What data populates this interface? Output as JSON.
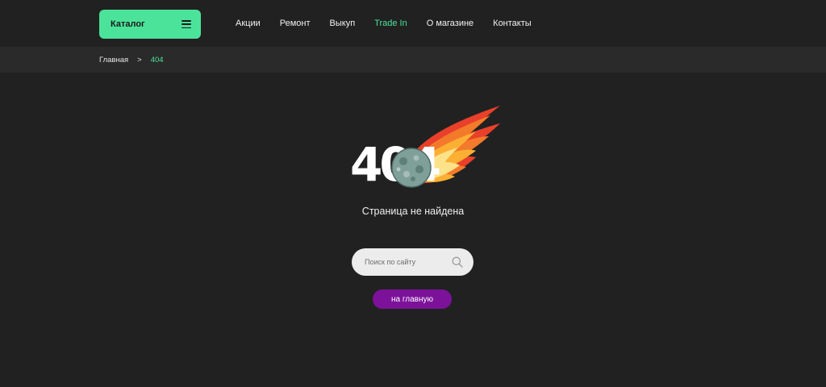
{
  "header": {
    "catalog_label": "Каталог",
    "nav": [
      "Акции",
      "Ремонт",
      "Выкуп",
      "Trade In",
      "О магазине",
      "Контакты"
    ],
    "active_item": "Trade In"
  },
  "breadcrumbs": {
    "home": "Главная",
    "separator": ">",
    "current": "404"
  },
  "error": {
    "code": "404",
    "message": "Страница не найдена"
  },
  "search": {
    "placeholder": "Поиск по сайту",
    "value": ""
  },
  "home_button": "на главную",
  "colors": {
    "background": "#212121",
    "accent": "#4be39a",
    "button": "#7c129a"
  },
  "icons": [
    "menu-icon",
    "search-icon",
    "meteor-illustration"
  ]
}
